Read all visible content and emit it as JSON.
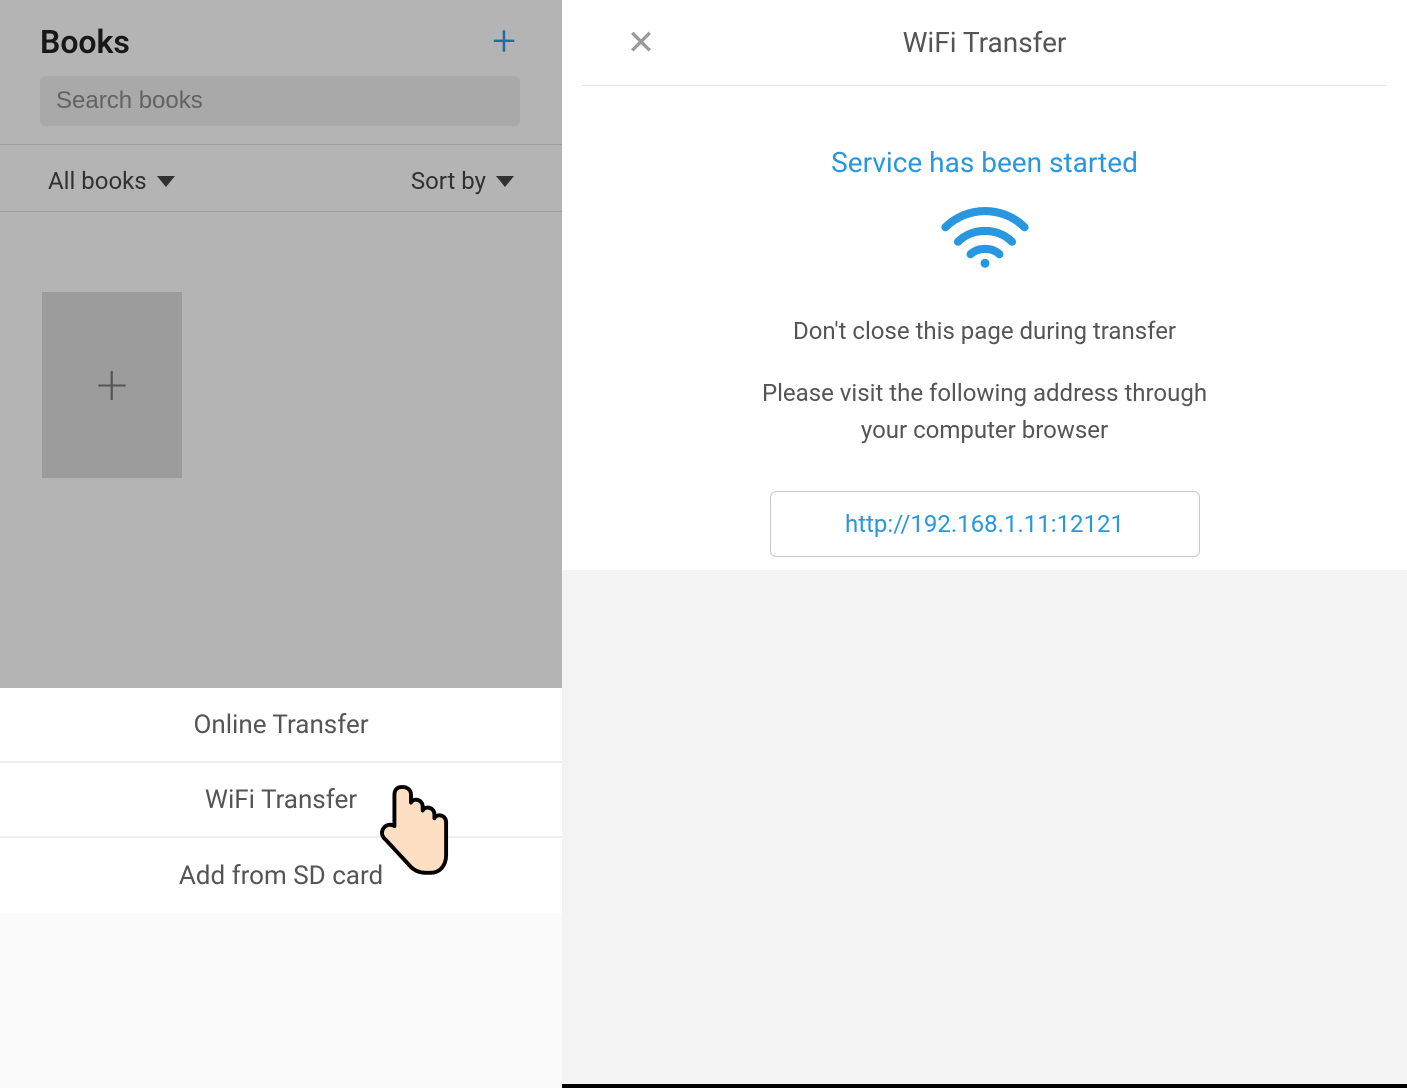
{
  "left": {
    "title": "Books",
    "search_placeholder": "Search books",
    "filter_label": "All books",
    "sort_label": "Sort by",
    "sheet": {
      "online": "Online Transfer",
      "wifi": "WiFi Transfer",
      "sd": "Add from SD card"
    }
  },
  "right": {
    "title": "WiFi Transfer",
    "status": "Service has been started",
    "hint1": "Don't close this page during transfer",
    "hint2": "Please visit the following address through your computer browser",
    "url": "http://192.168.1.11:12121"
  },
  "colors": {
    "accent": "#2897df"
  }
}
